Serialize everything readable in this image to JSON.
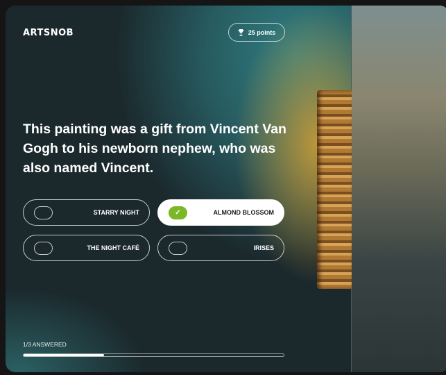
{
  "brand": "ARTSNOB",
  "points": {
    "icon": "trophy-icon",
    "label": "25 points"
  },
  "question": "This painting was a gift from Vincent Van Gogh to his newborn nephew, who was also named Vincent.",
  "options": [
    {
      "label": "STARRY NIGHT",
      "selected": false
    },
    {
      "label": "ALMOND BLOSSOM",
      "selected": true
    },
    {
      "label": "THE NIGHT CAFÉ",
      "selected": false
    },
    {
      "label": "IRISES",
      "selected": false
    }
  ],
  "progress": {
    "label": "1/3 ANSWERED",
    "fraction": 0.31
  },
  "colors": {
    "accent": "#7ab828",
    "background": "#1b292d"
  }
}
